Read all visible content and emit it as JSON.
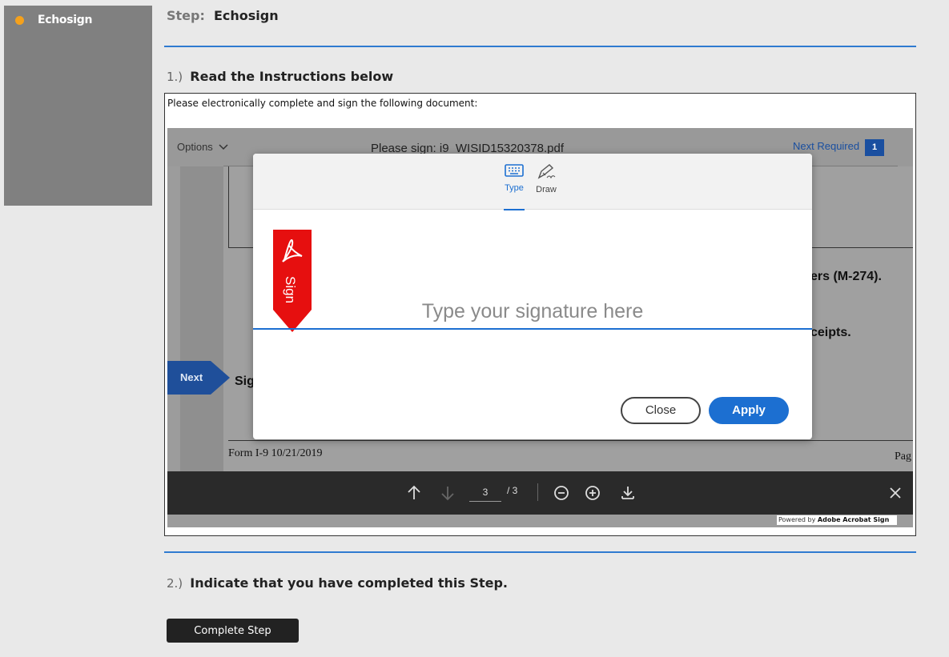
{
  "sidebar": {
    "item_label": "Echosign"
  },
  "step": {
    "prefix": "Step:",
    "name": "Echosign"
  },
  "instructions": [
    {
      "num": "1.)",
      "text": "Read the Instructions below"
    },
    {
      "num": "2.)",
      "text": "Indicate that you have completed this Step."
    }
  ],
  "doc_note": "Please electronically complete and sign the following document:",
  "viewer": {
    "options_label": "Options",
    "filename": "Please sign: i9_WISID15320378.pdf",
    "next_required_label": "Next Required",
    "next_required_count": "1",
    "page_text_1": "ers (M-274).",
    "page_text_2": "ceipts.",
    "page_text_3": "Sig",
    "form_label": "Form I-9  10/21/2019",
    "pag_label": "Pag",
    "next_label": "Next",
    "current_page": "3",
    "total_pages": "/ 3",
    "powered_prefix": "Powered by ",
    "powered_brand": "Adobe Acrobat Sign"
  },
  "modal": {
    "tab_type": "Type",
    "tab_draw": "Draw",
    "flag_text": "Sign",
    "signature_placeholder": "Type your signature here",
    "close_label": "Close",
    "apply_label": "Apply"
  },
  "complete_button": "Complete Step",
  "colors": {
    "accent": "#1c6fd1",
    "dot": "#f5a11c",
    "flag": "#e60f0f"
  }
}
